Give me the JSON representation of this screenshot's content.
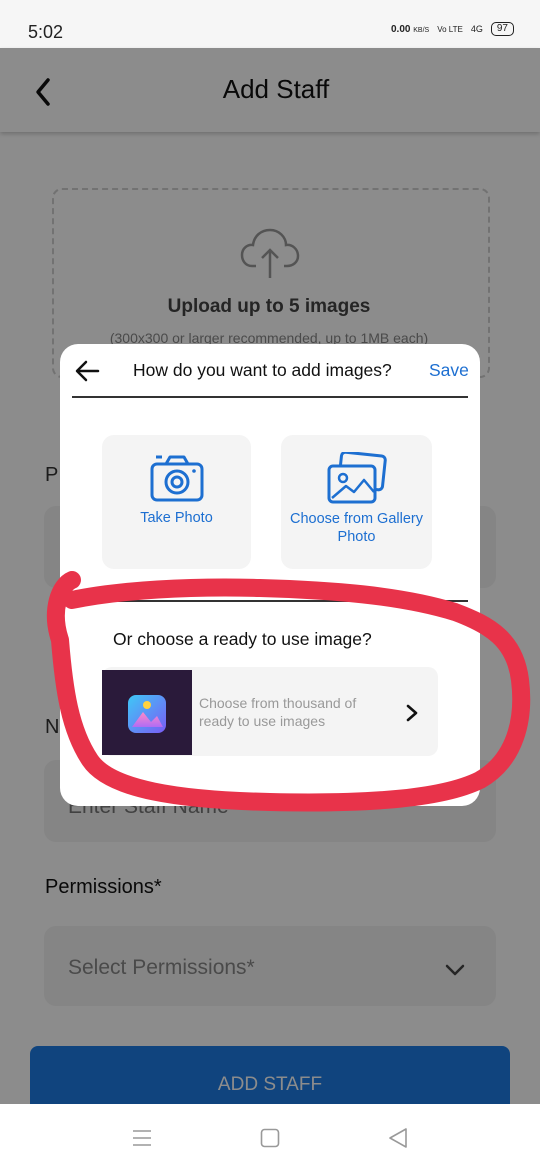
{
  "status_bar": {
    "time": "5:02",
    "net_speed": "0.00",
    "net_unit": "KB/S",
    "volte": "Vo LTE",
    "network": "4G",
    "battery": "97"
  },
  "app_bar": {
    "title": "Add Staff"
  },
  "upload": {
    "title": "Upload up to 5 images",
    "subtitle": "(300x300 or larger recommended, up to 1MB each)"
  },
  "form": {
    "field1_label_partial": "P",
    "name_label_partial": "N",
    "name_placeholder_partial": "Enter Staff Name",
    "permissions_label": "Permissions*",
    "permissions_placeholder": "Select Permissions*",
    "submit_label": "ADD STAFF"
  },
  "dialog": {
    "title": "How do you want to add images?",
    "save_label": "Save",
    "take_photo_label": "Take Photo",
    "gallery_label": "Choose from Gallery Photo",
    "ready_heading": "Or choose a ready to use image?",
    "ready_text": "Choose from thousand of ready to use images"
  },
  "icons": {
    "back": "chevron-left-icon",
    "upload": "cloud-upload-icon",
    "camera": "camera-icon",
    "gallery": "gallery-icon",
    "chevron_right": "chevron-right-icon",
    "chevron_down": "chevron-down-icon",
    "nav_menu": "menu-icon",
    "nav_home": "home-icon",
    "nav_back": "back-triangle-icon"
  },
  "colors": {
    "accent": "#1d6fd1",
    "button": "#1e7de6",
    "annotation": "#e8334a"
  }
}
